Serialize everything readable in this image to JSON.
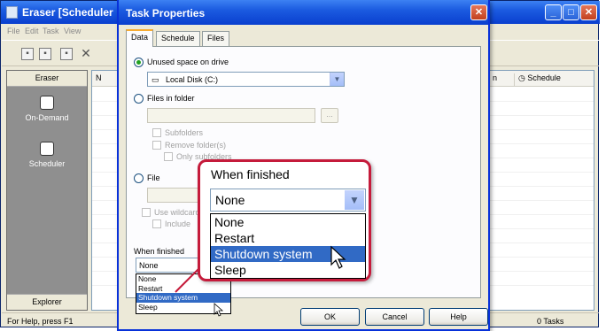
{
  "main_window": {
    "title": "Eraser  [Scheduler",
    "menu": [
      "File",
      "Edit",
      "Task",
      "View"
    ],
    "sidebar": {
      "header": "Eraser",
      "items": [
        {
          "label": "On-Demand"
        },
        {
          "label": "Scheduler"
        }
      ],
      "footer": "Explorer"
    },
    "list": {
      "col_name": "N",
      "col_mid": "n",
      "col_schedule": "Schedule"
    },
    "status": {
      "left": "For Help, press F1",
      "right": "0 Tasks"
    }
  },
  "dialog": {
    "title": "Task Properties",
    "tabs": [
      "Data",
      "Schedule",
      "Files"
    ],
    "options": {
      "unused_space": "Unused space on drive",
      "drive_value": "Local Disk (C:)",
      "files_in_folder": "Files in folder",
      "browse_label": "...",
      "subfolders": "Subfolders",
      "remove_folders": "Remove folder(s)",
      "only_subfolders": "Only subfolders",
      "file": "File",
      "use_wildcards": "Use wildcard",
      "include": "Include"
    },
    "when_finished": {
      "label": "When finished",
      "value": "None",
      "options": [
        "None",
        "Restart",
        "Shutdown system",
        "Sleep"
      ],
      "selected_index": 2
    },
    "buttons": {
      "ok": "OK",
      "cancel": "Cancel",
      "help": "Help"
    }
  },
  "zoom_callout": {
    "label": "When finished",
    "value": "None",
    "options": [
      "None",
      "Restart",
      "Shutdown system",
      "Sleep"
    ],
    "selected_index": 2,
    "border_color": "#c51b3b"
  }
}
